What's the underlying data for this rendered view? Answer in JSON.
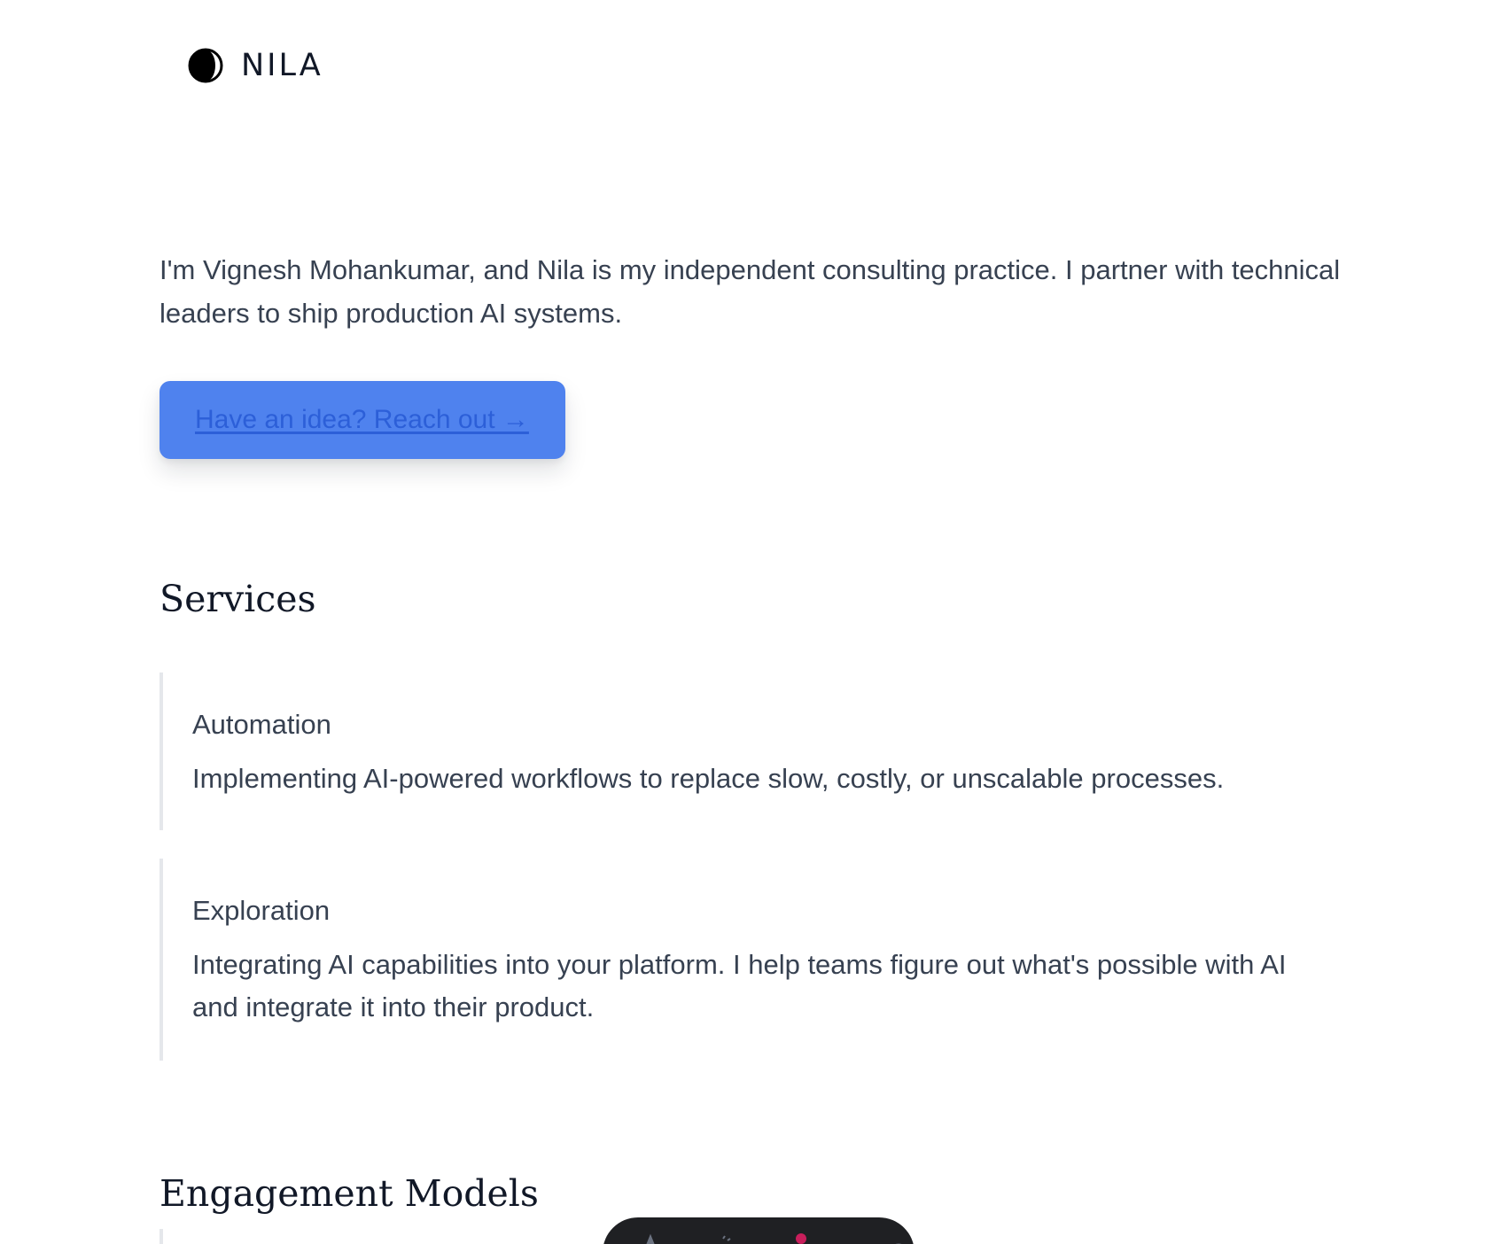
{
  "header": {
    "brand": "NILA",
    "logo_icon": "crescent-moon-icon"
  },
  "hero": {
    "intro": "I'm Vignesh Mohankumar, and Nila is my independent consulting practice. I partner with technical leaders to ship production AI systems.",
    "cta_label": "Have an idea? Reach out →"
  },
  "services": {
    "title": "Services",
    "items": [
      {
        "title": "Automation",
        "description": "Implementing AI-powered workflows to replace slow, costly, or unscalable processes."
      },
      {
        "title": "Exploration",
        "description": "Integrating AI capabilities into your platform. I help teams figure out what's possible with AI and integrate it into their product."
      }
    ]
  },
  "engagement": {
    "title": "Engagement Models"
  },
  "toolbar": {
    "icons": [
      "text-icon",
      "pen-icon",
      "menu-icon",
      "gear-icon"
    ],
    "notification_color": "#c81e5b"
  },
  "colors": {
    "accent": "#4f82ee",
    "link": "#2c5fd8",
    "text": "#374151",
    "heading": "#111827",
    "rule": "#e5e7eb"
  }
}
